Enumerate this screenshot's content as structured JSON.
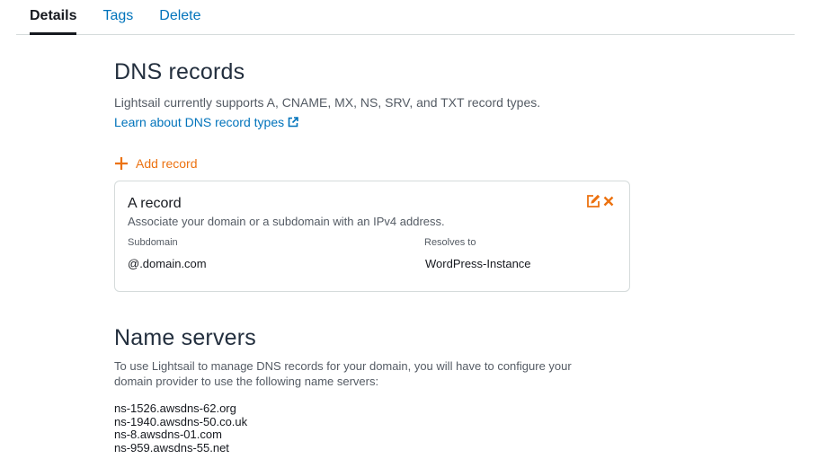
{
  "tabs": [
    {
      "label": "Details",
      "active": true
    },
    {
      "label": "Tags",
      "active": false
    },
    {
      "label": "Delete",
      "active": false
    }
  ],
  "dns": {
    "title": "DNS records",
    "description": "Lightsail currently supports A, CNAME, MX, NS, SRV, and TXT record types.",
    "learn_link": "Learn about DNS record types",
    "add_record_label": "Add record"
  },
  "record": {
    "title": "A record",
    "description": "Associate your domain or a subdomain with an IPv4 address.",
    "subdomain_label": "Subdomain",
    "subdomain_value": "@.domain.com",
    "resolves_label": "Resolves to",
    "resolves_value": "WordPress-Instance"
  },
  "name_servers": {
    "title": "Name servers",
    "description": "To use Lightsail to manage DNS records for your domain, you will have to configure your domain provider to use the following name servers:",
    "servers": [
      "ns-1526.awsdns-62.org",
      "ns-1940.awsdns-50.co.uk",
      "ns-8.awsdns-01.com",
      "ns-959.awsdns-55.net"
    ]
  },
  "colors": {
    "link": "#0073bb",
    "accent": "#ec7211",
    "text": "#16191f",
    "muted": "#545b64",
    "border": "#d5dbdb"
  },
  "icons": {
    "external_link": "external-link-icon",
    "add": "plus-icon",
    "edit": "edit-icon",
    "delete": "close-icon"
  }
}
